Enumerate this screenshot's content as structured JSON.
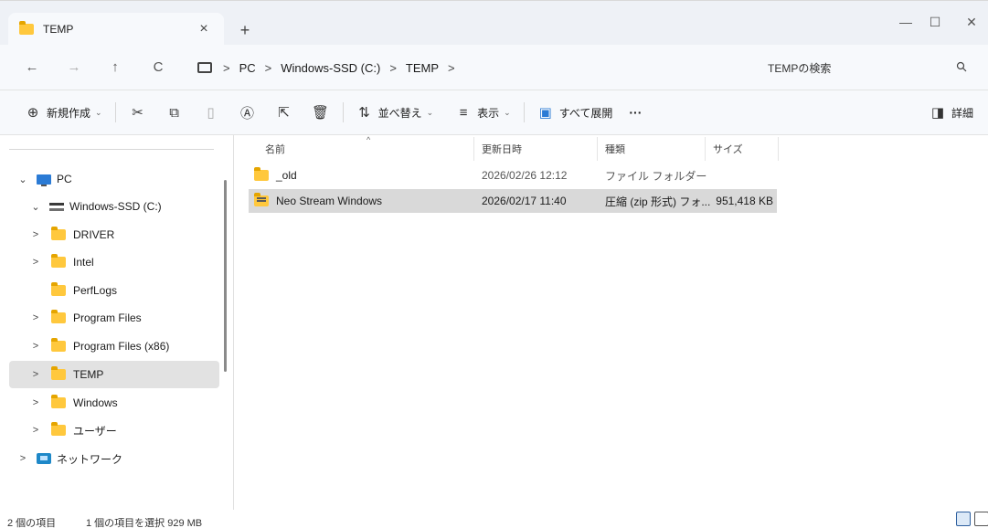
{
  "window": {
    "tab_title": "TEMP",
    "tab_close": "×",
    "new_tab": "+",
    "minimize": "—",
    "maximize": "☐",
    "close": "✕"
  },
  "address_bar": {
    "back": "←",
    "forward": "→",
    "up": "↑",
    "refresh": "C",
    "breadcrumbs": [
      "PC",
      "Windows-SSD (C:)",
      "TEMP"
    ],
    "separator": ">",
    "search_placeholder": "TEMPの検索"
  },
  "command_bar": {
    "new_label": "新規作成",
    "sort_label": "並べ替え",
    "view_label": "表示",
    "expand_all_label": "すべて展開",
    "more_label": "···",
    "details_label": "詳細"
  },
  "sidebar": {
    "items": [
      {
        "label": "PC",
        "chevron": "⌄"
      },
      {
        "label": "Windows-SSD (C:)",
        "chevron": "⌄"
      },
      {
        "label": "DRIVER",
        "chevron": ">"
      },
      {
        "label": "Intel",
        "chevron": ">"
      },
      {
        "label": "PerfLogs",
        "chevron": ""
      },
      {
        "label": "Program Files",
        "chevron": ">"
      },
      {
        "label": "Program Files (x86)",
        "chevron": ">"
      },
      {
        "label": "TEMP",
        "chevron": ">"
      },
      {
        "label": "Windows",
        "chevron": ">"
      },
      {
        "label": "ユーザー",
        "chevron": ">"
      },
      {
        "label": "ネットワーク",
        "chevron": ">"
      }
    ]
  },
  "file_list": {
    "columns": [
      "名前",
      "更新日時",
      "種類",
      "サイズ"
    ],
    "sort_indicator": "^",
    "rows": [
      {
        "name": "_old",
        "modified": "2026/02/26 12:12",
        "type": "ファイル フォルダー",
        "size": ""
      },
      {
        "name": "Neo Stream Windows",
        "modified": "2026/02/17 11:40",
        "type": "圧縮 (zip 形式) フォ...",
        "size": "951,418 KB"
      }
    ]
  },
  "status_bar": {
    "item_count": "2 個の項目",
    "selection": "1 個の項目を選択 929 MB"
  },
  "colors": {
    "chrome_bg": "#f7f9fc",
    "selection_bg": "#d9d9d9",
    "folder_yellow": "#ffc83d"
  }
}
